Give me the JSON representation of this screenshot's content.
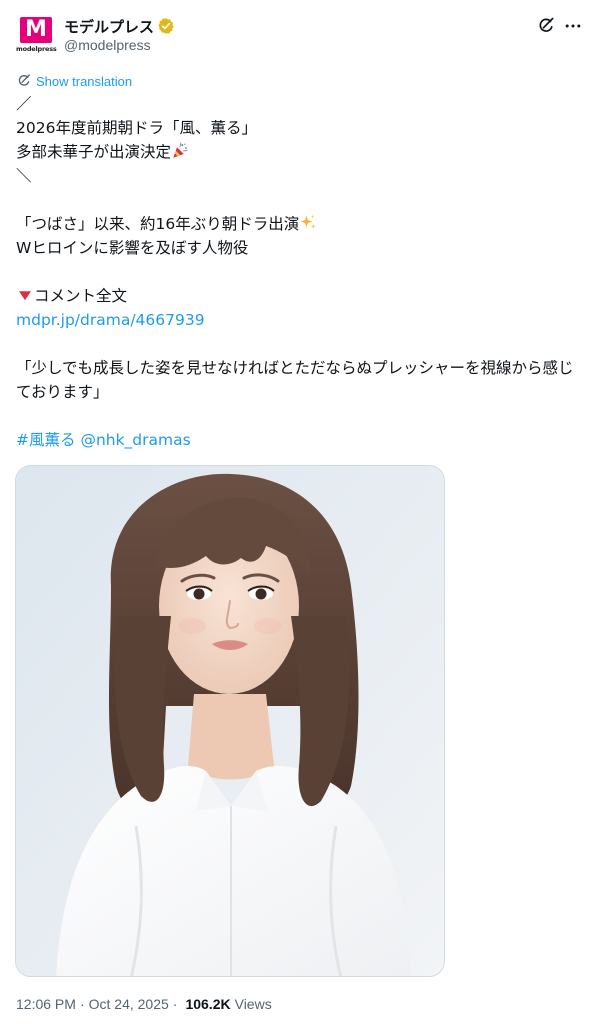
{
  "author": {
    "display_name": "モデルプレス",
    "handle": "@modelpress",
    "avatar_logo": "M",
    "avatar_sub": "modelpress",
    "verified_color": "#e2b719"
  },
  "translate": {
    "label": "Show translation"
  },
  "body": {
    "line1": "／",
    "line2": "2026年度前期朝ドラ「風、薫る」",
    "line3": "多部未華子が出演決定",
    "line4": "＼",
    "line5": "「つばさ」以来、約16年ぶり朝ドラ出演",
    "line6": "Wヒロインに影響を及ぼす人物役",
    "line7": "コメント全文",
    "link": "mdpr.jp/drama/4667939",
    "quote": "「少しでも成長した姿を見せなければとただならぬプレッシャーを視線から感じております」",
    "hashtag": "#風薫る",
    "mention": "@nhk_dramas"
  },
  "media": {
    "kind": "photo-portrait"
  },
  "footer": {
    "time": "12:06 PM",
    "date": "Oct 24, 2025",
    "separator": "·",
    "views_count": "106.2K",
    "views_label": "Views"
  },
  "icons": {
    "grok": "grok-icon",
    "more": "more-icon",
    "translate": "translate-icon",
    "verified": "verified-icon",
    "party": "party-popper-icon",
    "sparkles": "sparkles-icon",
    "triangle": "red-triangle-down-icon"
  },
  "colors": {
    "accent": "#1d9bf0",
    "text": "#0f1419",
    "muted": "#536471",
    "brand": "#e4007f"
  }
}
